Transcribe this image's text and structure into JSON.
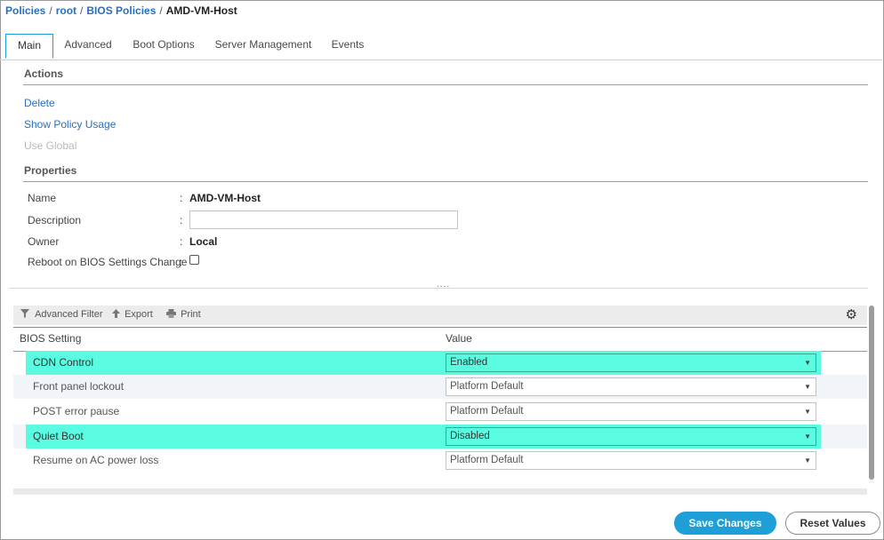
{
  "breadcrumb": {
    "items": [
      "Policies",
      "root",
      "BIOS Policies"
    ],
    "separator": "/",
    "current": "AMD-VM-Host"
  },
  "tabs": [
    {
      "label": "Main",
      "active": true
    },
    {
      "label": "Advanced",
      "active": false
    },
    {
      "label": "Boot Options",
      "active": false
    },
    {
      "label": "Server Management",
      "active": false
    },
    {
      "label": "Events",
      "active": false
    }
  ],
  "actions": {
    "title": "Actions",
    "items": [
      {
        "label": "Delete",
        "enabled": true
      },
      {
        "label": "Show Policy Usage",
        "enabled": true
      },
      {
        "label": "Use Global",
        "enabled": false
      }
    ]
  },
  "properties": {
    "title": "Properties",
    "colon": ":",
    "name": {
      "label": "Name",
      "value": "AMD-VM-Host"
    },
    "description": {
      "label": "Description",
      "value": "",
      "placeholder": ""
    },
    "owner": {
      "label": "Owner",
      "value": "Local"
    },
    "reboot": {
      "label": "Reboot on BIOS Settings Change",
      "checked": false
    }
  },
  "splitter": {
    "grip": "...."
  },
  "toolbar": {
    "advanced_filter": "Advanced Filter",
    "export": "Export",
    "print": "Print",
    "icons": [
      "filter-icon",
      "export-icon",
      "print-icon",
      "gear-icon"
    ]
  },
  "grid": {
    "columns": [
      "BIOS Setting",
      "Value"
    ],
    "rows": [
      {
        "setting": "CDN Control",
        "value": "Enabled",
        "highlighted": true
      },
      {
        "setting": "Front panel lockout",
        "value": "Platform Default",
        "highlighted": false
      },
      {
        "setting": "POST error pause",
        "value": "Platform Default",
        "highlighted": false
      },
      {
        "setting": "Quiet Boot",
        "value": "Disabled",
        "highlighted": true
      },
      {
        "setting": "Resume on AC power loss",
        "value": "Platform Default",
        "highlighted": false
      }
    ]
  },
  "buttons": {
    "save": "Save Changes",
    "reset": "Reset Values"
  },
  "colors": {
    "link": "#2a6ebb",
    "accent": "#1e9fd8",
    "highlight": "#5afce1",
    "disabled": "#b9b9b9"
  }
}
